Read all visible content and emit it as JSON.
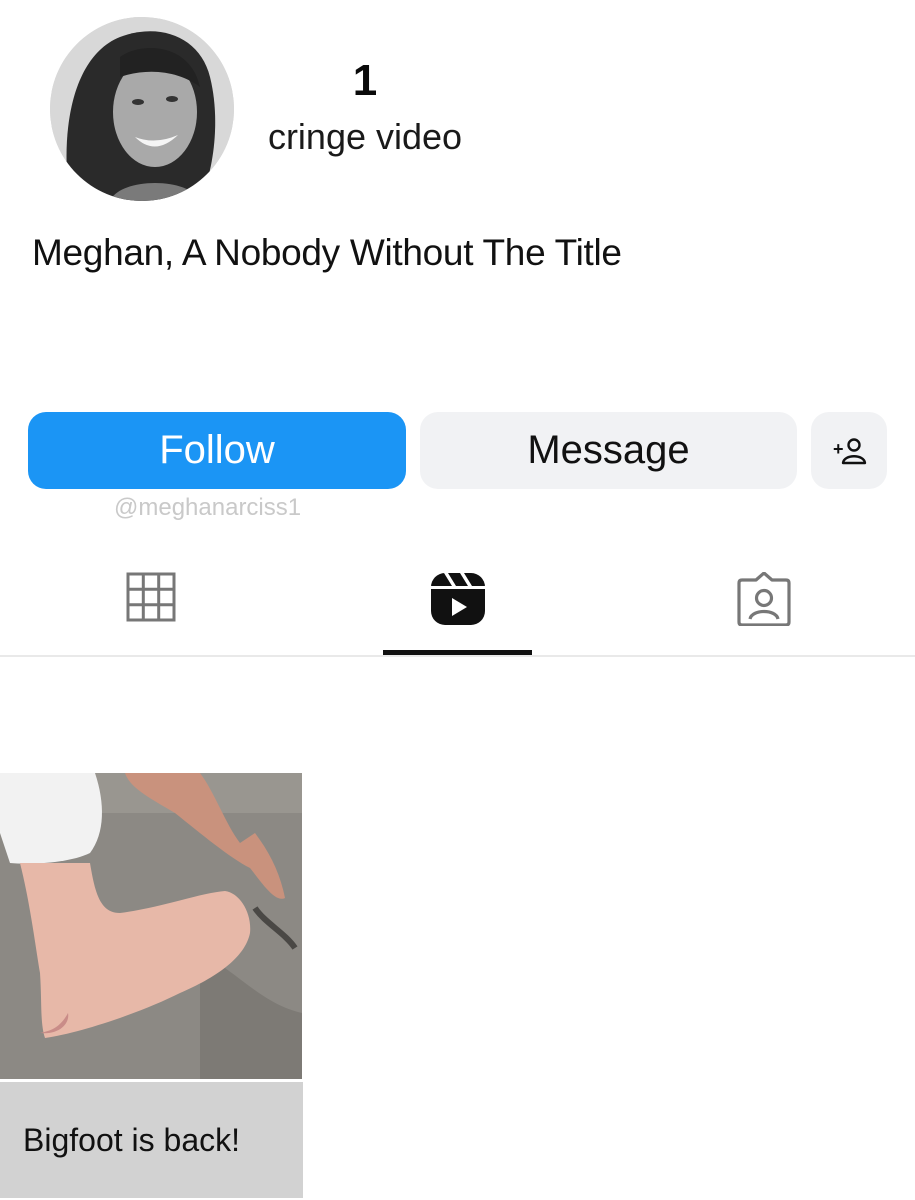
{
  "profile": {
    "stat_count": "1",
    "stat_label": "cringe video",
    "display_name": "Meghan, A Nobody Without The Title",
    "handle": "@meghanarciss1"
  },
  "actions": {
    "follow_label": "Follow",
    "message_label": "Message",
    "add_user_icon": "add-person-icon"
  },
  "tabs": [
    {
      "icon": "grid-icon",
      "active": false
    },
    {
      "icon": "reels-icon",
      "active": true
    },
    {
      "icon": "tagged-icon",
      "active": false
    }
  ],
  "posts": [
    {
      "caption": "Bigfoot is back!"
    }
  ],
  "colors": {
    "follow_button": "#1b95f5",
    "secondary_button": "#f1f2f4",
    "active_tab_indicator": "#111111",
    "handle_text": "#c9c9c9"
  }
}
